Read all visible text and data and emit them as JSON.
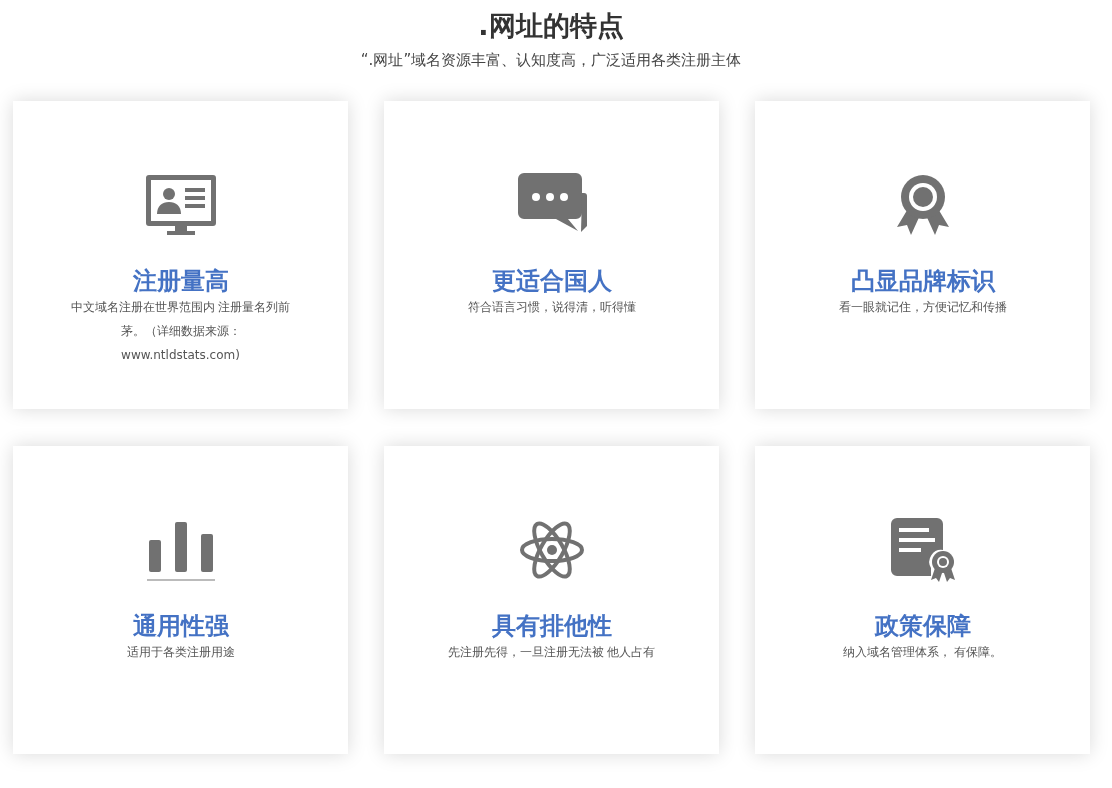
{
  "heading": {
    "title": ".网址的特点",
    "subtitle": "“.网址”域名资源丰富、认知度高，广泛适用各类注册主体"
  },
  "features": [
    {
      "title": "注册量高",
      "text": "中文域名注册在世界范围内 注册量名列前茅。（详细数据来源：www.ntldstats.com)"
    },
    {
      "title": "更适合国人",
      "text": "符合语言习惯，说得清，听得懂"
    },
    {
      "title": "凸显品牌标识",
      "text": "看一眼就记住，方便记忆和传播"
    },
    {
      "title": "通用性强",
      "text": "适用于各类注册用途"
    },
    {
      "title": "具有排他性",
      "text": "先注册先得，一旦注册无法被 他人占有"
    },
    {
      "title": "政策保障",
      "text": "纳入域名管理体系， 有保障。"
    }
  ]
}
